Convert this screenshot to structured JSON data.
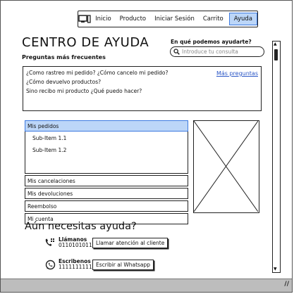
{
  "nav": {
    "icon": "computer-icon",
    "items": [
      {
        "label": "Inicio"
      },
      {
        "label": "Producto"
      },
      {
        "label": "Iniciar Sesión"
      },
      {
        "label": "Carrito"
      },
      {
        "label": "Ayuda",
        "active": true
      }
    ]
  },
  "page": {
    "title": "CENTRO DE AYUDA",
    "subtitle": "Preguntas más frecuentes"
  },
  "search": {
    "label": "En qué podemos ayudarte?",
    "placeholder": "Introduce tu consulta",
    "icon": "search-icon"
  },
  "faq": {
    "lines": [
      "¿Como rastreo mi pedido?  ¿Cómo cancelo mi pedido?",
      "¿Cómo devuelvo productos?",
      "Sino recibo mi producto ¿Qué puedo hacer?"
    ],
    "more_link": "Más preguntas"
  },
  "menu": {
    "selected": "Mis pedidos",
    "subitems": [
      "Sub-Item 1.1",
      "Sub-Item 1.2"
    ],
    "items": [
      "Mis cancelaciones",
      "Mis devoluciones",
      "Reembolso",
      "Mi cuenta"
    ]
  },
  "contact": {
    "title": "Aún necesitas ayuda?",
    "phone": {
      "label": "Llámanos",
      "number": "011010101101",
      "button": "Llamar atención al cliente",
      "icon": "phone-icon"
    },
    "whatsapp": {
      "label": "Escribenos",
      "number": "1111111111",
      "button": "Escribir al Whatsapp",
      "icon": "whatsapp-icon"
    }
  },
  "colors": {
    "accent": "#bcd6f8",
    "accent_border": "#3d7ae0",
    "link": "#2a56c6",
    "statusbar": "#bdbdbd"
  }
}
